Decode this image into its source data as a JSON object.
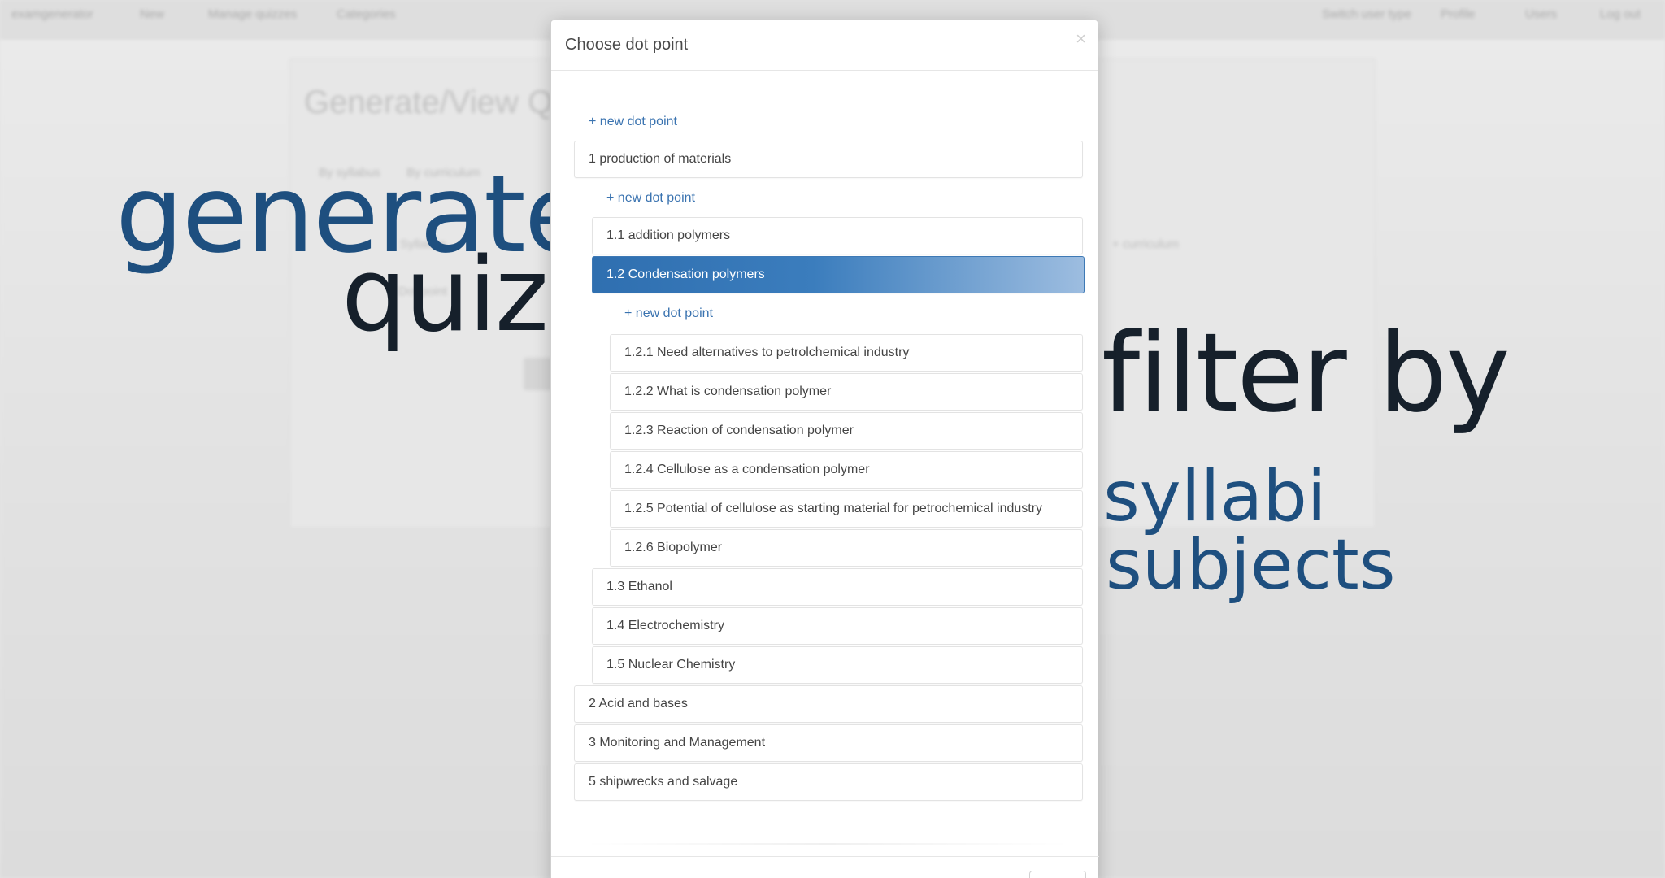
{
  "background": {
    "navbar": {
      "brand": "examgenerator",
      "items": [
        "New",
        "Manage quizzes",
        "Categories"
      ],
      "right_items": [
        "Switch user type",
        "Profile",
        "Users",
        "Log out"
      ]
    },
    "heading": "Generate/View Q",
    "tabs": [
      "By syllabus",
      "By curriculum"
    ],
    "labels": [
      "Syllabus",
      "Dot point",
      "+ curriculum"
    ]
  },
  "promo": {
    "line1": "generate",
    "line2": "quiz",
    "line3": "filter by",
    "line4": "syllabi",
    "line5": "subjects"
  },
  "modal": {
    "title": "Choose dot point",
    "close_symbol": "×",
    "new_dot_point": "+ new dot point",
    "items": {
      "l1_1": "1 production of materials",
      "l2_1": "1.1 addition polymers",
      "l2_2": "1.2 Condensation polymers",
      "l3_1": "1.2.1 Need alternatives to petrolchemical industry",
      "l3_2": "1.2.2 What is condensation polymer",
      "l3_3": "1.2.3 Reaction of condensation polymer",
      "l3_4": "1.2.4 Cellulose as a condensation polymer",
      "l3_5": "1.2.5 Potential of cellulose as starting material for petrochemical industry",
      "l3_6": "1.2.6 Biopolymer",
      "l2_3": "1.3 Ethanol",
      "l2_4": "1.4 Electrochemistry",
      "l2_5": "1.5 Nuclear Chemistry",
      "l1_2": "2 Acid and bases",
      "l1_3": "3 Monitoring and Management",
      "l1_4": "5 shipwrecks and salvage"
    },
    "selected": "1.2 Condensation polymers"
  }
}
